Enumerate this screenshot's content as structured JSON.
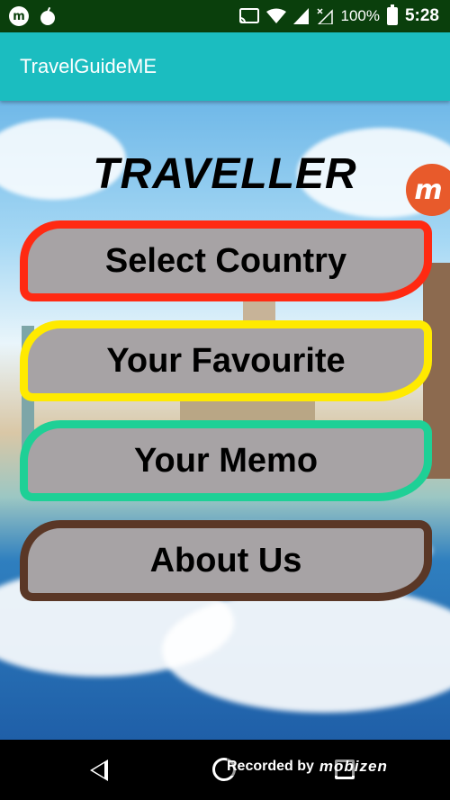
{
  "status_bar": {
    "left_icons": [
      "mobizen-icon",
      "bomb-icon"
    ],
    "right_icons": [
      "cast-icon",
      "wifi-icon",
      "signal-icon",
      "no-sim-signal-icon",
      "battery-icon"
    ],
    "battery": "100%",
    "time": "5:28"
  },
  "app_bar": {
    "title": "TravelGuideME"
  },
  "main": {
    "headline": "TRAVELLER",
    "badge_letter": "m",
    "buttons": [
      {
        "label": "Select Country",
        "border_color": "#ff2a12"
      },
      {
        "label": "Your Favourite",
        "border_color": "#ffea00"
      },
      {
        "label": "Your Memo",
        "border_color": "#1ed096"
      },
      {
        "label": "About Us",
        "border_color": "#5a3726"
      }
    ]
  },
  "nav_bar": {
    "icons": [
      "back-icon",
      "home-icon",
      "recents-icon"
    ],
    "watermark_prefix": "Recorded by",
    "watermark_brand": "mobizen"
  }
}
